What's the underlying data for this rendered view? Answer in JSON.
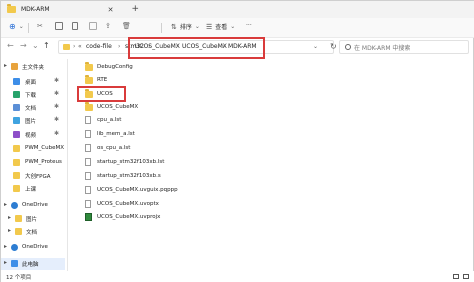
{
  "window": {
    "title": "MDK-ARM",
    "new_tab": "+"
  },
  "commands": {
    "new": "⊕",
    "sort": "排序",
    "view": "查看",
    "more": "···"
  },
  "address": {
    "breadcrumbs": [
      "code-file",
      "stm32",
      "UCOS_CubeMX",
      "UCOS_CubeMX",
      "MDK-ARM"
    ],
    "overflow": "«"
  },
  "search": {
    "placeholder": "在 MDK-ARM 中搜索"
  },
  "sidebar": {
    "items": [
      {
        "label": "主文件夹",
        "icon": "home-icon",
        "pinned": false,
        "expand": "▸"
      },
      {
        "label": "桌面",
        "icon": "desktop-icon",
        "pinned": true
      },
      {
        "label": "下载",
        "icon": "download-icon",
        "pinned": true
      },
      {
        "label": "文档",
        "icon": "documents-icon",
        "pinned": true
      },
      {
        "label": "图片",
        "icon": "pictures-icon",
        "pinned": true
      },
      {
        "label": "视频",
        "icon": "videos-icon",
        "pinned": true
      },
      {
        "label": "PWM_CubeMX",
        "icon": "folder-icon",
        "pinned": false
      },
      {
        "label": "PWM_Proteus",
        "icon": "folder-icon",
        "pinned": false
      },
      {
        "label": "大创FPGA",
        "icon": "folder-icon",
        "pinned": false
      },
      {
        "label": "上课",
        "icon": "folder-icon",
        "pinned": false
      },
      {
        "label": "OneDrive",
        "icon": "cloud-icon",
        "pinned": false,
        "expand": "▸"
      },
      {
        "label": "图片",
        "icon": "pictures-icon",
        "pinned": false,
        "expand": "▸"
      },
      {
        "label": "文档",
        "icon": "folder-icon",
        "pinned": false,
        "expand": "▸"
      },
      {
        "label": "OneDrive",
        "icon": "cloud-icon",
        "pinned": false,
        "expand": "▸"
      },
      {
        "label": "此电脑",
        "icon": "pc-icon",
        "pinned": false,
        "expand": "▸"
      }
    ]
  },
  "files": [
    {
      "name": "DebugConfig",
      "type": "folder"
    },
    {
      "name": "RTE",
      "type": "folder"
    },
    {
      "name": "UCOS",
      "type": "folder"
    },
    {
      "name": "UCOS_CubeMX",
      "type": "folder"
    },
    {
      "name": "cpu_a.lst",
      "type": "file"
    },
    {
      "name": "lib_mem_a.lst",
      "type": "file"
    },
    {
      "name": "os_cpu_a.lst",
      "type": "file"
    },
    {
      "name": "startup_stm32f103xb.lst",
      "type": "file"
    },
    {
      "name": "startup_stm32f103xb.s",
      "type": "file"
    },
    {
      "name": "UCOS_CubeMX.uvguix.pqppp",
      "type": "file"
    },
    {
      "name": "UCOS_CubeMX.uvoptx",
      "type": "file"
    },
    {
      "name": "UCOS_CubeMX.uvprojx",
      "type": "project"
    }
  ],
  "status": {
    "count": "12 个项目"
  },
  "colors": {
    "highlight": "#d93b3b",
    "folder": "#f2c94c",
    "selected": "#e5eefc"
  }
}
